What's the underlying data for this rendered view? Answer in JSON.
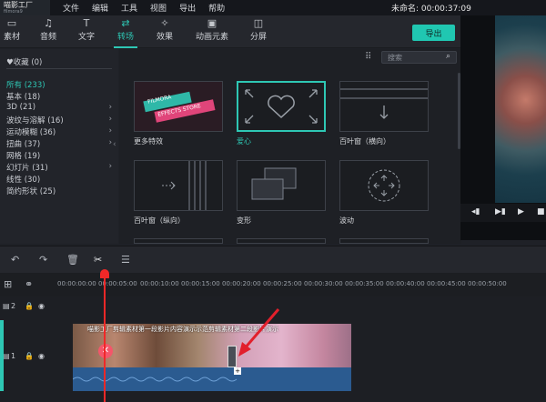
{
  "app": {
    "logo_line1": "喵影工厂",
    "logo_line2": "filmora9",
    "menu": [
      "文件",
      "编辑",
      "工具",
      "视图",
      "导出",
      "帮助"
    ],
    "project_title": "未命名: 00:00:37:09"
  },
  "tabs": [
    {
      "label": "素材",
      "icon": "folder-icon"
    },
    {
      "label": "音频",
      "icon": "music-note-icon"
    },
    {
      "label": "文字",
      "icon": "text-icon"
    },
    {
      "label": "转场",
      "icon": "transition-icon",
      "active": true
    },
    {
      "label": "效果",
      "icon": "effects-star-icon"
    },
    {
      "label": "动画元素",
      "icon": "image-icon"
    },
    {
      "label": "分屏",
      "icon": "split-screen-icon"
    }
  ],
  "export_label": "导出",
  "sidebar": {
    "favorites": "♥收藏 (0)",
    "items": [
      {
        "label": "所有 (233)",
        "active": true,
        "chevron": false
      },
      {
        "label": "基本 (18)",
        "chevron": false
      },
      {
        "label": "3D (21)",
        "chevron": true
      },
      {
        "label": "波纹与溶解 (16)",
        "chevron": true
      },
      {
        "label": "运动模糊 (36)",
        "chevron": true
      },
      {
        "label": "扭曲 (37)",
        "chevron": true
      },
      {
        "label": "网格 (19)",
        "chevron": false
      },
      {
        "label": "幻灯片 (31)",
        "chevron": true
      },
      {
        "label": "线性 (30)",
        "chevron": false
      },
      {
        "label": "简约形状 (25)",
        "chevron": false
      }
    ]
  },
  "search": {
    "placeholder": "搜索"
  },
  "transitions": [
    {
      "label": "更多特效",
      "badge1": "FILMORA",
      "badge2": "EFFECTS STORE"
    },
    {
      "label": "爱心",
      "selected": true
    },
    {
      "label": "百叶窗（横向）"
    },
    {
      "label": "百叶窗（纵向）"
    },
    {
      "label": "变形"
    },
    {
      "label": "波动"
    }
  ],
  "timeline": {
    "ticks": [
      "00:00:00:00",
      "00:00:05:00",
      "00:00:10:00",
      "00:00:15:00",
      "00:00:20:00",
      "00:00:25:00",
      "00:00:30:00",
      "00:00:35:00",
      "00:00:40:00",
      "00:00:45:00",
      "00:00:50:00"
    ],
    "track2_label": "2",
    "track1_label": "1",
    "clip_caption": "喵影工厂剪辑素材第一段影片内容演示示范剪辑素材第二段影片演示"
  },
  "colors": {
    "accent": "#2ec7b4",
    "playhead": "#f02828",
    "audio": "#2b5b90"
  }
}
